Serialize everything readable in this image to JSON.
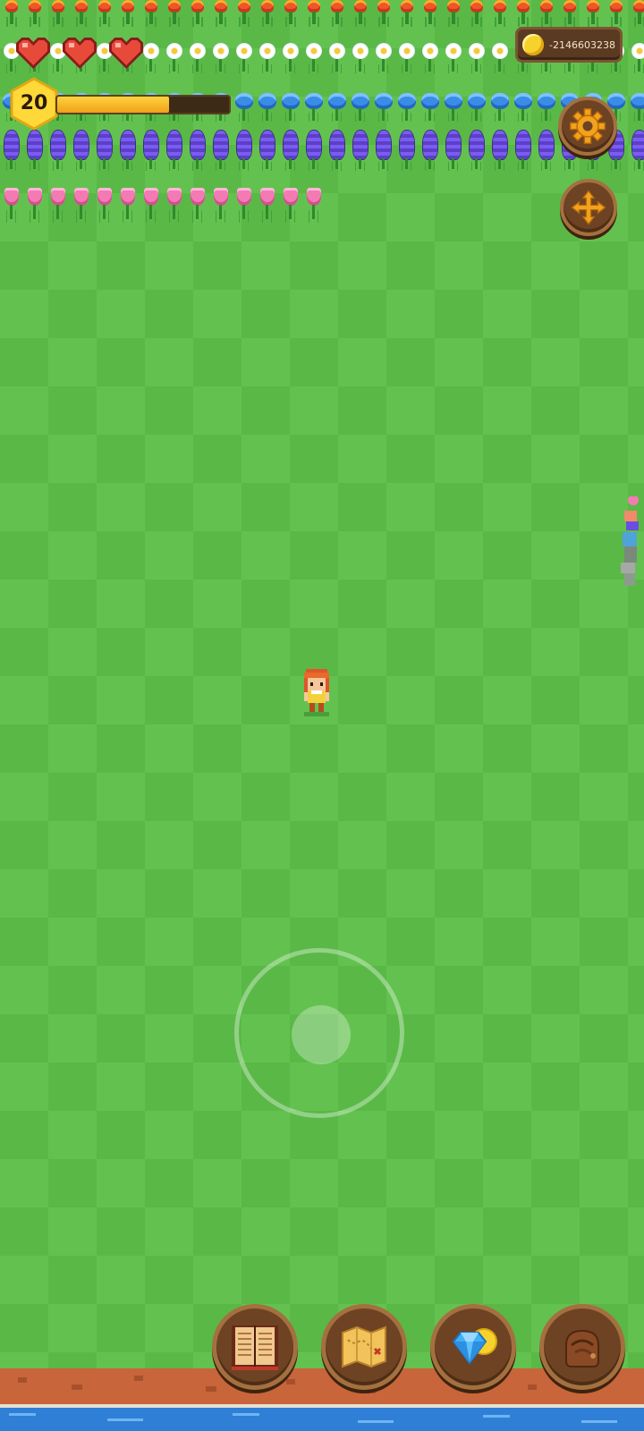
{
  "hud": {
    "hearts": {
      "current": 3,
      "max": 3
    },
    "coins": {
      "value": "-2146603238",
      "icon": "coin-icon"
    },
    "level": {
      "value": "20",
      "xp_fraction": 0.65
    },
    "settings_icon": "gear-icon",
    "move_icon": "move-arrows-icon"
  },
  "scene": {
    "flower_rows": [
      {
        "name": "red-flowers",
        "color": "#f0562b"
      },
      {
        "name": "daisies",
        "color": "#ffffff"
      },
      {
        "name": "blue-flowers",
        "color": "#3a8de6"
      },
      {
        "name": "purple-hyacinths",
        "color": "#6b4ee0"
      },
      {
        "name": "pink-tulips",
        "color": "#f47ab3"
      }
    ],
    "grass_color": "#63c24f",
    "character": "player-character"
  },
  "toolbar": {
    "buttons": [
      {
        "name": "journal",
        "icon": "book-icon"
      },
      {
        "name": "map",
        "icon": "map-icon"
      },
      {
        "name": "shop",
        "icon": "gem-coin-icon"
      },
      {
        "name": "inventory",
        "icon": "bag-icon"
      }
    ]
  }
}
